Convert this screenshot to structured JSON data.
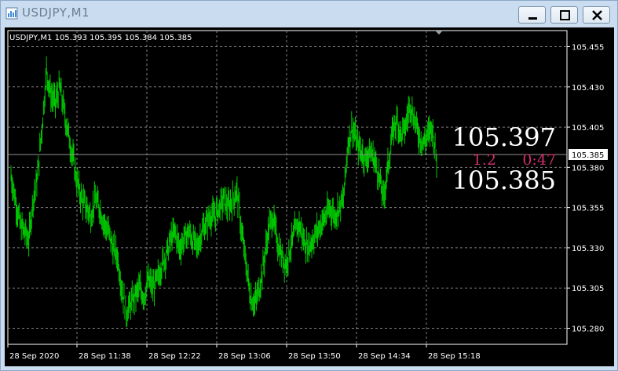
{
  "window": {
    "title": "USDJPY,M1",
    "buttons": {
      "minimize": "minimize",
      "maximize": "maximize",
      "close": "close"
    }
  },
  "chart": {
    "info_line": "USDJPY,M1  105.393 105.395 105.384 105.385",
    "current_price_label": "105.385",
    "overlay": {
      "ask": "105.397",
      "spread": "1.2",
      "timer": "0:47",
      "bid": "105.385"
    },
    "price_axis": [
      "105.455",
      "105.430",
      "105.405",
      "105.380",
      "105.355",
      "105.330",
      "105.305",
      "105.280"
    ],
    "time_axis": [
      "28 Sep 2020",
      "28 Sep 11:38",
      "28 Sep 12:22",
      "28 Sep 13:06",
      "28 Sep 13:50",
      "28 Sep 14:34",
      "28 Sep 15:18"
    ],
    "colors": {
      "background": "#000000",
      "bars": "#00c800",
      "grid": "#808080",
      "overlay_text": "#ffffff",
      "overlay_accent": "#cc2f6b"
    }
  },
  "chart_data": {
    "type": "line",
    "title": "USDJPY,M1",
    "xlabel": "",
    "ylabel": "",
    "ylim": [
      105.27,
      105.465
    ],
    "x_ticks": [
      "28 Sep 2020",
      "28 Sep 11:38",
      "28 Sep 12:22",
      "28 Sep 13:06",
      "28 Sep 13:50",
      "28 Sep 14:34",
      "28 Sep 15:18"
    ],
    "series": [
      {
        "values": [
          105.375,
          105.36,
          105.345,
          105.34,
          105.335,
          105.36,
          105.375,
          105.405,
          105.44,
          105.425,
          105.42,
          105.43,
          105.415,
          105.4,
          105.385,
          105.37,
          105.36,
          105.355,
          105.35,
          105.36,
          105.355,
          105.345,
          105.34,
          105.33,
          105.325,
          105.305,
          105.29,
          105.295,
          105.3,
          105.305,
          105.3,
          105.31,
          105.305,
          105.31,
          105.32,
          105.325,
          105.335,
          105.34,
          105.33,
          105.335,
          105.34,
          105.335,
          105.33,
          105.34,
          105.345,
          105.35,
          105.35,
          105.355,
          105.36,
          105.355,
          105.36,
          105.365,
          105.34,
          105.32,
          105.3,
          105.295,
          105.305,
          105.32,
          105.34,
          105.35,
          105.335,
          105.325,
          105.32,
          105.33,
          105.34,
          105.345,
          105.335,
          105.33,
          105.335,
          105.34,
          105.345,
          105.35,
          105.355,
          105.35,
          105.355,
          105.36,
          105.395,
          105.405,
          105.395,
          105.39,
          105.385,
          105.39,
          105.385,
          105.375,
          105.36,
          105.38,
          105.4,
          105.41,
          105.4,
          105.405,
          105.42,
          105.41,
          105.4,
          105.395,
          105.4,
          105.405,
          105.385
        ]
      }
    ]
  }
}
